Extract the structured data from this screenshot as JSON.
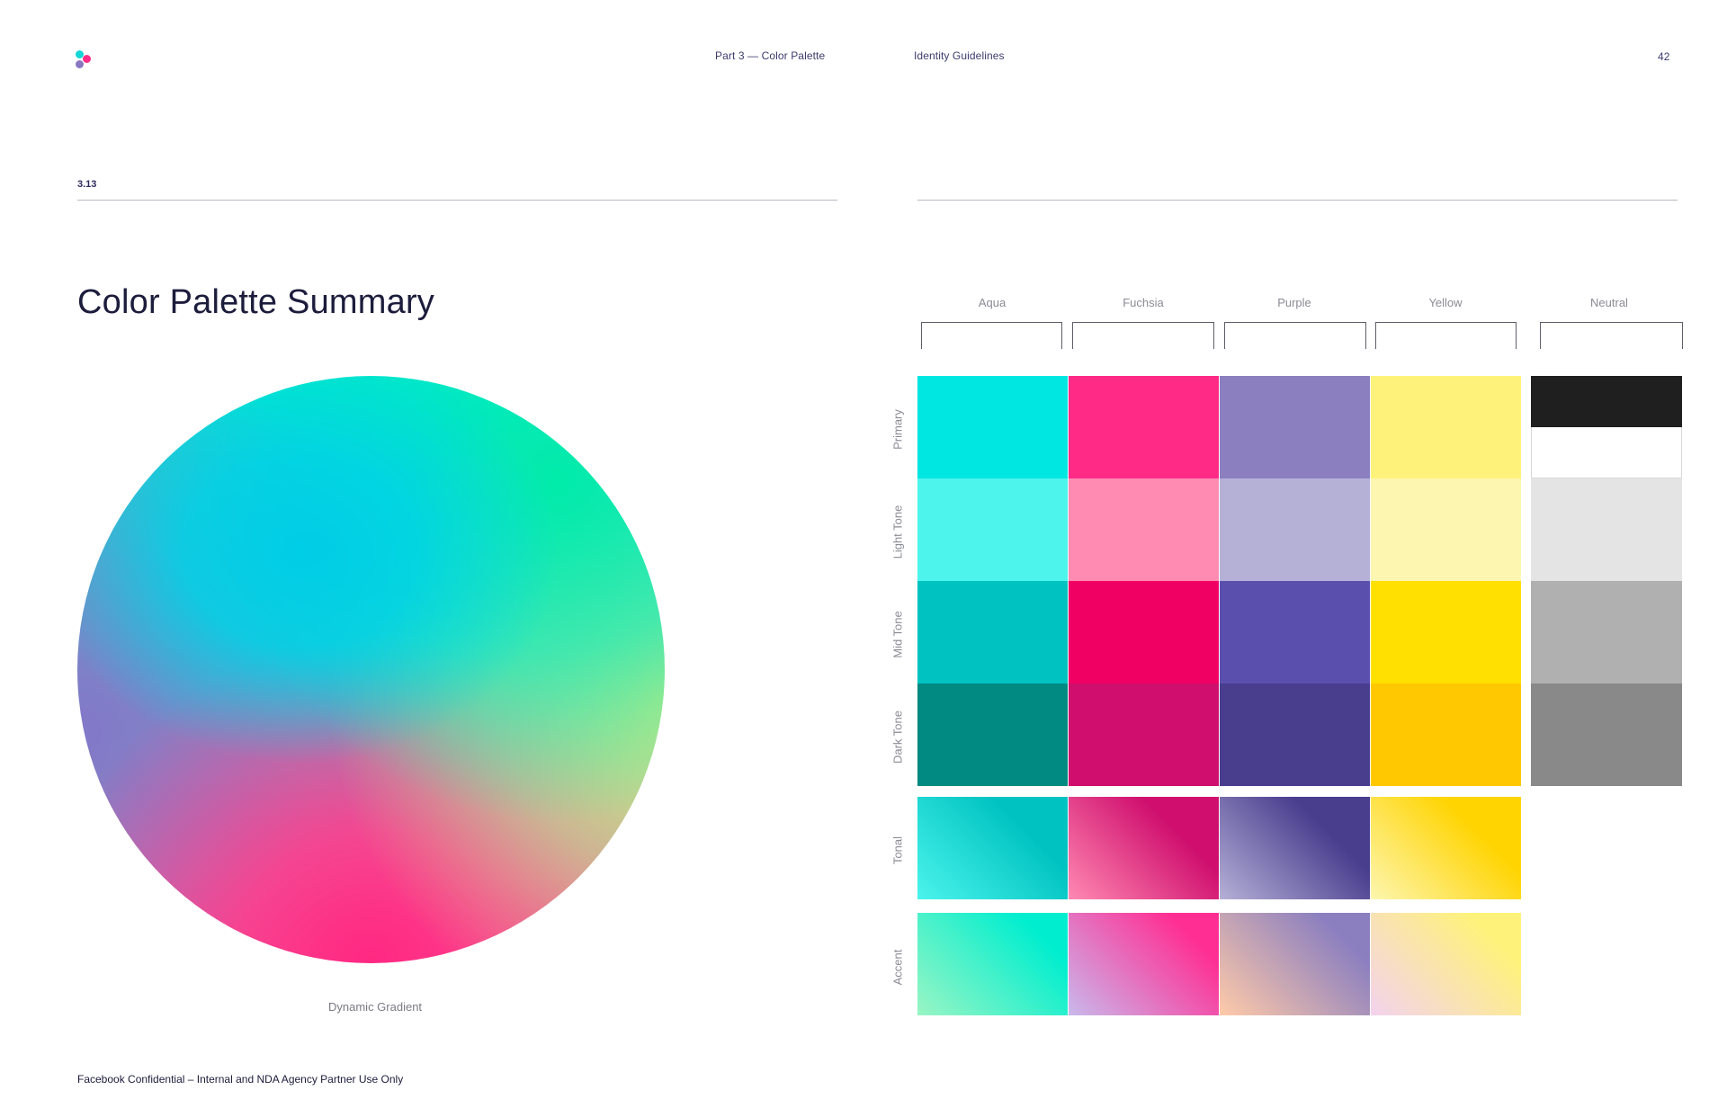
{
  "header": {
    "left_running_head": "Part 3 — Color Palette",
    "right_running_head": "Identity Guidelines",
    "page_number": "42"
  },
  "logo": {
    "colors": [
      "#14d6d6",
      "#ff2d87",
      "#8a77c2"
    ]
  },
  "section": {
    "number": "3.13",
    "title": "Color Palette Summary"
  },
  "gradient_caption": "Dynamic Gradient",
  "footer_text": "Facebook Confidential – Internal and NDA Agency Partner Use Only",
  "palette": {
    "columns": [
      "Aqua",
      "Fuchsia",
      "Purple",
      "Yellow",
      "Neutral"
    ],
    "rows": [
      "Primary",
      "Light Tone",
      "Mid Tone",
      "Dark Tone",
      "Tonal",
      "Accent"
    ],
    "solid": {
      "Primary": [
        "#00e6e0",
        "#ff2a85",
        "#8b7fc0",
        "#fff27a"
      ],
      "Light Tone": [
        "#4cf4ec",
        "#ff8ab2",
        "#b5b0d6",
        "#fdf6b0"
      ],
      "Mid Tone": [
        "#00c3c1",
        "#f10064",
        "#5b4fae",
        "#ffe000"
      ],
      "Dark Tone": [
        "#008a82",
        "#cf0e6e",
        "#493d8e",
        "#ffc800"
      ]
    },
    "neutral": [
      "#1f1f1f",
      "#ffffff",
      "#e4e4e4",
      "#b0b0b0",
      "#898989"
    ],
    "tonal": [
      [
        "#4cf4ec",
        "#00c3c1"
      ],
      [
        "#ff8ab2",
        "#cf0e6e"
      ],
      [
        "#b5b0d6",
        "#493d8e"
      ],
      [
        "#fdf6b0",
        "#ffd400"
      ]
    ],
    "accent": [
      [
        "#9af5c4",
        "#00eecf"
      ],
      [
        "#c9b9ec",
        "#ff2e93"
      ],
      [
        "#ffcaa8",
        "#8b7fc0"
      ],
      [
        "#f3d2ee",
        "#fff27a"
      ]
    ]
  }
}
